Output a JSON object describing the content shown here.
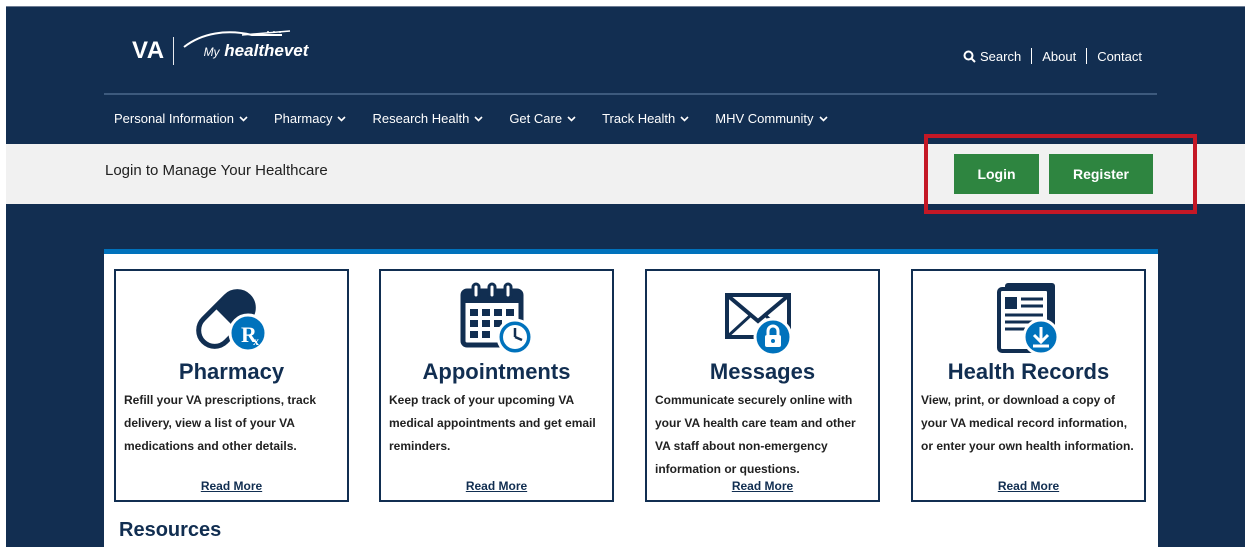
{
  "header": {
    "logo_va": "VA",
    "logo_my": "My",
    "logo_brand": "healthevet",
    "util_links": {
      "search": "Search",
      "about": "About",
      "contact": "Contact"
    }
  },
  "nav": [
    {
      "label": "Personal Information"
    },
    {
      "label": "Pharmacy"
    },
    {
      "label": "Research Health"
    },
    {
      "label": "Get Care"
    },
    {
      "label": "Track Health"
    },
    {
      "label": "MHV Community"
    }
  ],
  "loginbar": {
    "text": "Login to Manage Your Healthcare",
    "login_label": "Login",
    "register_label": "Register"
  },
  "cards": [
    {
      "icon": "pill-rx-icon",
      "title": "Pharmacy",
      "desc": "Refill your VA prescriptions, track delivery, view a list of your VA medications and other details.",
      "more": "Read More"
    },
    {
      "icon": "calendar-clock-icon",
      "title": "Appointments",
      "desc": "Keep track of your upcoming VA medical appointments and get email reminders.",
      "more": "Read More"
    },
    {
      "icon": "envelope-lock-icon",
      "title": "Messages",
      "desc": "Communicate securely online with your VA health care team and other VA staff about non-emergency information or questions.",
      "more": "Read More"
    },
    {
      "icon": "records-download-icon",
      "title": "Health Records",
      "desc": "View, print, or download a copy of your VA medical record information, or enter your own health information.",
      "more": "Read More"
    }
  ],
  "resources_heading": "Resources",
  "colors": {
    "navy": "#112e51",
    "green": "#2e8540",
    "blue": "#0072bc",
    "highlight_red": "#c41826"
  }
}
